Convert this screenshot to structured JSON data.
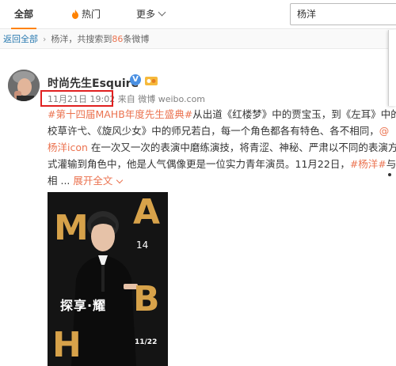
{
  "tabs": {
    "all": "全部",
    "hot": "热门",
    "more": "更多"
  },
  "search": {
    "value": "杨洋"
  },
  "breadcrumb": {
    "back": "返回全部",
    "query": "杨洋",
    "summary_prefix": "，共搜索到",
    "count": "86",
    "summary_suffix": "条微博"
  },
  "post": {
    "author": "时尚先生Esquire",
    "verified": "V",
    "time": "11月21日 19:02",
    "source": "来自 微博 weibo.com",
    "line1_tag": "#第十四届MAHB年度先生盛典#",
    "line1_text": "从出道《红楼梦》中的贾宝玉，到《左耳》中的",
    "line2_text": "校草许弋、《旋风少女》中的师兄若白，每一个角色都各有特色、各不相同，",
    "line2_at": "@",
    "line3_link": "杨洋icon",
    "line3_text": " 在一次又一次的表演中磨练演技，将青涩、神秘、严肃以不同的表演方",
    "line4_text": "式灌输到角色中，他是人气偶像更是一位实力青年演员。11月22日，",
    "line4_tag": "#杨洋#",
    "line4_tail": "与",
    "line5_text": "相 ...",
    "expand": "展开全文",
    "expand_icon": "chevron-down"
  },
  "poster": {
    "letters": [
      "M",
      "A",
      "H",
      "B"
    ],
    "number": "14",
    "title": "探享·耀",
    "date": "11/22"
  },
  "colors": {
    "accent": "#ff8200",
    "link": "#2a7ab0",
    "tag": "#eb7350",
    "highlight_box": "#e02020"
  }
}
